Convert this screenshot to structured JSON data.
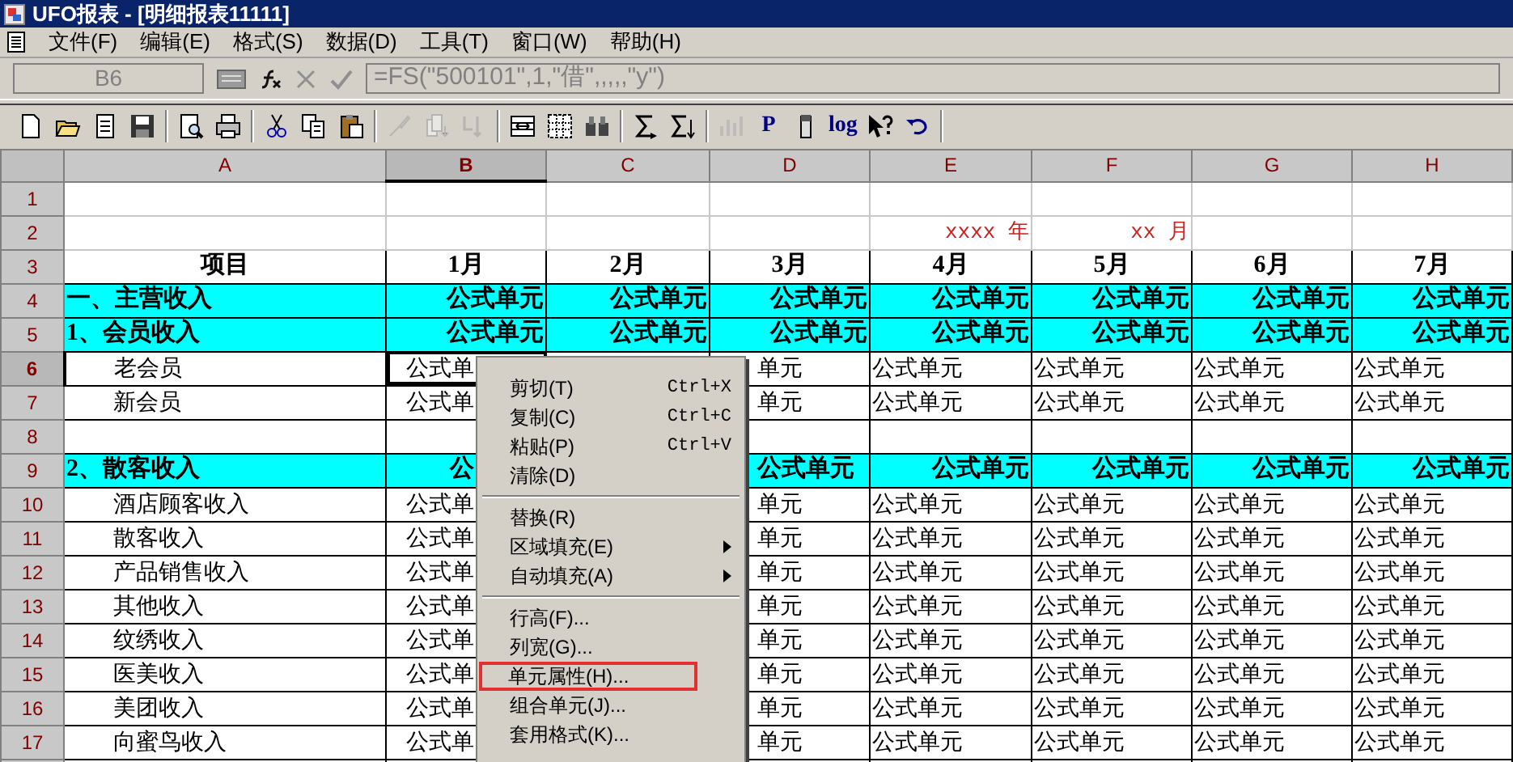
{
  "window": {
    "title": "UFO报表 - [明细报表11111]"
  },
  "menu_bar": [
    "文件(F)",
    "编辑(E)",
    "格式(S)",
    "数据(D)",
    "工具(T)",
    "窗口(W)",
    "帮助(H)"
  ],
  "formula_bar": {
    "cell_name": "B6",
    "formula": "=FS(\"500101\",1,\"借\",,,,,\"y\")"
  },
  "toolbar": [
    {
      "kind": "new",
      "disabled": false
    },
    {
      "kind": "open",
      "disabled": false
    },
    {
      "kind": "doc",
      "disabled": false
    },
    {
      "kind": "save",
      "disabled": false
    },
    {
      "kind": "sep"
    },
    {
      "kind": "preview",
      "disabled": false
    },
    {
      "kind": "print",
      "disabled": false
    },
    {
      "kind": "sep"
    },
    {
      "kind": "cut",
      "disabled": false
    },
    {
      "kind": "copy",
      "disabled": false
    },
    {
      "kind": "paste",
      "disabled": false
    },
    {
      "kind": "sep"
    },
    {
      "kind": "brush",
      "disabled": true
    },
    {
      "kind": "fill-down",
      "disabled": true
    },
    {
      "kind": "sort",
      "disabled": true
    },
    {
      "kind": "sep"
    },
    {
      "kind": "merge",
      "disabled": false
    },
    {
      "kind": "grid",
      "disabled": false
    },
    {
      "kind": "find",
      "disabled": false
    },
    {
      "kind": "sep"
    },
    {
      "kind": "sum",
      "disabled": false
    },
    {
      "kind": "sum-down",
      "disabled": false
    },
    {
      "kind": "sep"
    },
    {
      "kind": "chart",
      "disabled": true
    },
    {
      "kind": "text",
      "label": "P",
      "disabled": false
    },
    {
      "kind": "pen",
      "disabled": false
    },
    {
      "kind": "text",
      "label": "log",
      "disabled": false
    },
    {
      "kind": "help",
      "disabled": false
    },
    {
      "kind": "undo",
      "disabled": false
    },
    {
      "kind": "sep"
    }
  ],
  "columns": [
    {
      "label": "A",
      "selected": false
    },
    {
      "label": "B",
      "selected": true
    },
    {
      "label": "C",
      "selected": false
    },
    {
      "label": "D",
      "selected": false
    },
    {
      "label": "E",
      "selected": false
    },
    {
      "label": "F",
      "selected": false
    },
    {
      "label": "G",
      "selected": false
    },
    {
      "label": "H",
      "selected": false
    }
  ],
  "rows": [
    {
      "label": "1",
      "selected": false,
      "kind": "plain",
      "cells": {}
    },
    {
      "label": "2",
      "selected": false,
      "kind": "date",
      "cells": {
        "E": "xxxx 年",
        "F": "xx 月"
      }
    },
    {
      "label": "3",
      "selected": false,
      "kind": "title",
      "cells": {
        "A": "项目",
        "B": "1月",
        "C": "2月",
        "D": "3月",
        "E": "4月",
        "F": "5月",
        "G": "6月",
        "H": "7月"
      }
    },
    {
      "label": "4",
      "selected": false,
      "kind": "section",
      "cells": {
        "A": "一、主营收入",
        "B": "公式单元",
        "C": "公式单元",
        "D": "公式单元",
        "E": "公式单元",
        "F": "公式单元",
        "G": "公式单元",
        "H": "公式单元"
      }
    },
    {
      "label": "5",
      "selected": false,
      "kind": "section",
      "cells": {
        "A": "1、会员收入",
        "B": "公式单元",
        "C": "公式单元",
        "D": "公式单元",
        "E": "公式单元",
        "F": "公式单元",
        "G": "公式单元",
        "H": "公式单元"
      }
    },
    {
      "label": "6",
      "selected": true,
      "kind": "item",
      "cells": {
        "A": "老会员",
        "B": "公式单",
        "D": "单元",
        "E": "公式单元",
        "F": "公式单元",
        "G": "公式单元",
        "H": "公式单元"
      }
    },
    {
      "label": "7",
      "selected": false,
      "kind": "item",
      "cells": {
        "A": "新会员",
        "B": "公式单",
        "D": "单元",
        "E": "公式单元",
        "F": "公式单元",
        "G": "公式单元",
        "H": "公式单元"
      }
    },
    {
      "label": "8",
      "selected": false,
      "kind": "item",
      "cells": {}
    },
    {
      "label": "9",
      "selected": false,
      "kind": "section",
      "cells": {
        "A": "2、散客收入",
        "B": "公",
        "D": "公式单元",
        "E": "公式单元",
        "F": "公式单元",
        "G": "公式单元",
        "H": "公式单元"
      }
    },
    {
      "label": "10",
      "selected": false,
      "kind": "item",
      "cells": {
        "A": "酒店顾客收入",
        "B": "公式单",
        "D": "单元",
        "E": "公式单元",
        "F": "公式单元",
        "G": "公式单元",
        "H": "公式单元"
      }
    },
    {
      "label": "11",
      "selected": false,
      "kind": "item",
      "cells": {
        "A": "散客收入",
        "B": "公式单",
        "D": "单元",
        "E": "公式单元",
        "F": "公式单元",
        "G": "公式单元",
        "H": "公式单元"
      }
    },
    {
      "label": "12",
      "selected": false,
      "kind": "item",
      "cells": {
        "A": "产品销售收入",
        "B": "公式单",
        "D": "单元",
        "E": "公式单元",
        "F": "公式单元",
        "G": "公式单元",
        "H": "公式单元"
      }
    },
    {
      "label": "13",
      "selected": false,
      "kind": "item",
      "cells": {
        "A": "其他收入",
        "B": "公式单",
        "D": "单元",
        "E": "公式单元",
        "F": "公式单元",
        "G": "公式单元",
        "H": "公式单元"
      }
    },
    {
      "label": "14",
      "selected": false,
      "kind": "item",
      "cells": {
        "A": "纹绣收入",
        "B": "公式单",
        "D": "单元",
        "E": "公式单元",
        "F": "公式单元",
        "G": "公式单元",
        "H": "公式单元"
      }
    },
    {
      "label": "15",
      "selected": false,
      "kind": "item",
      "cells": {
        "A": "医美收入",
        "B": "公式单",
        "D": "单元",
        "E": "公式单元",
        "F": "公式单元",
        "G": "公式单元",
        "H": "公式单元"
      }
    },
    {
      "label": "16",
      "selected": false,
      "kind": "item",
      "cells": {
        "A": "美团收入",
        "B": "公式单",
        "D": "单元",
        "E": "公式单元",
        "F": "公式单元",
        "G": "公式单元",
        "H": "公式单元"
      }
    },
    {
      "label": "17",
      "selected": false,
      "kind": "item",
      "cells": {
        "A": "向蜜鸟收入",
        "B": "公式单",
        "D": "单元",
        "E": "公式单元",
        "F": "公式单元",
        "G": "公式单元",
        "H": "公式单元"
      }
    }
  ],
  "context_menu": [
    {
      "kind": "item",
      "label": "剪切(T)",
      "shortcut": "Ctrl+X",
      "submenu": false,
      "highlighted": false
    },
    {
      "kind": "item",
      "label": "复制(C)",
      "shortcut": "Ctrl+C",
      "submenu": false,
      "highlighted": false
    },
    {
      "kind": "item",
      "label": "粘贴(P)",
      "shortcut": "Ctrl+V",
      "submenu": false,
      "highlighted": false
    },
    {
      "kind": "item",
      "label": "清除(D)",
      "submenu": false,
      "highlighted": false
    },
    {
      "kind": "separator"
    },
    {
      "kind": "item",
      "label": "替换(R)",
      "submenu": false,
      "highlighted": false
    },
    {
      "kind": "item",
      "label": "区域填充(E)",
      "submenu": true,
      "highlighted": false
    },
    {
      "kind": "item",
      "label": "自动填充(A)",
      "submenu": true,
      "highlighted": false
    },
    {
      "kind": "separator"
    },
    {
      "kind": "item",
      "label": "行高(F)...",
      "submenu": false,
      "highlighted": false
    },
    {
      "kind": "item",
      "label": "列宽(G)...",
      "submenu": false,
      "highlighted": false
    },
    {
      "kind": "item",
      "label": "单元属性(H)...",
      "submenu": false,
      "highlighted": true
    },
    {
      "kind": "item",
      "label": "组合单元(J)...",
      "submenu": false,
      "highlighted": false
    },
    {
      "kind": "item",
      "label": "套用格式(K)...",
      "submenu": false,
      "highlighted": false
    }
  ]
}
